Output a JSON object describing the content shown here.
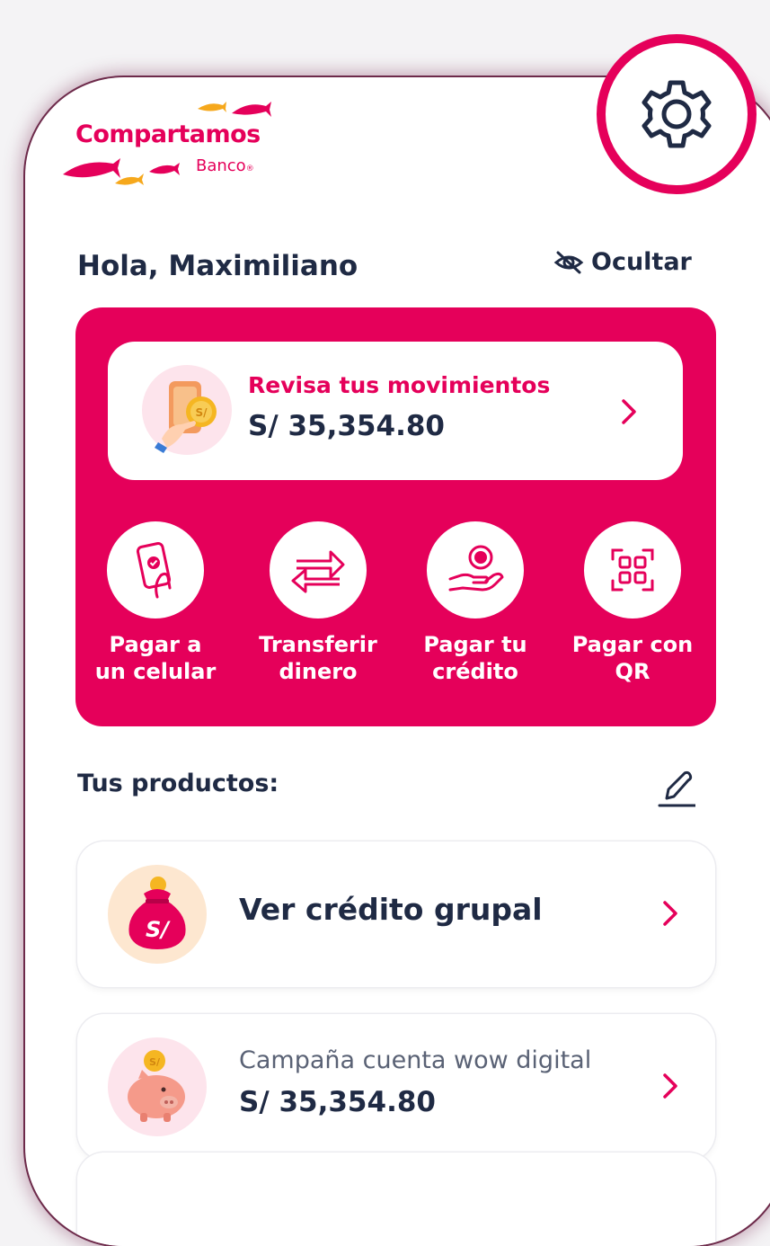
{
  "brand": {
    "name": "Compartamos",
    "sub": "Banco",
    "reg": "®",
    "accent": "#e5005a",
    "fish_colors": [
      "#e5005a",
      "#f6a81c"
    ]
  },
  "header": {
    "greeting": "Hola, Maximiliano",
    "hide_label": "Ocultar",
    "hide_icon": "eye-slash-icon",
    "settings_icon": "gear-icon"
  },
  "movements": {
    "title": "Revisa tus movimientos",
    "amount": "S/ 35,354.80",
    "coin_label": "S/"
  },
  "actions": [
    {
      "label": "Pagar a\nun celular",
      "icon": "phone-check-icon"
    },
    {
      "label": "Transferir\ndinero",
      "icon": "transfer-arrows-icon"
    },
    {
      "label": "Pagar tu\ncrédito",
      "icon": "hand-coin-icon"
    },
    {
      "label": "Pagar con\nQR",
      "icon": "qr-icon"
    }
  ],
  "products": {
    "title": "Tus productos:",
    "edit_icon": "pencil-icon",
    "items": [
      {
        "name": "Ver crédito grupal",
        "icon": "money-bag-icon",
        "bag_label": "S/"
      },
      {
        "name": "Campaña cuenta wow digital",
        "amount": "S/ 35,354.80",
        "icon": "piggy-bank-icon",
        "coin_label": "S/"
      }
    ]
  }
}
